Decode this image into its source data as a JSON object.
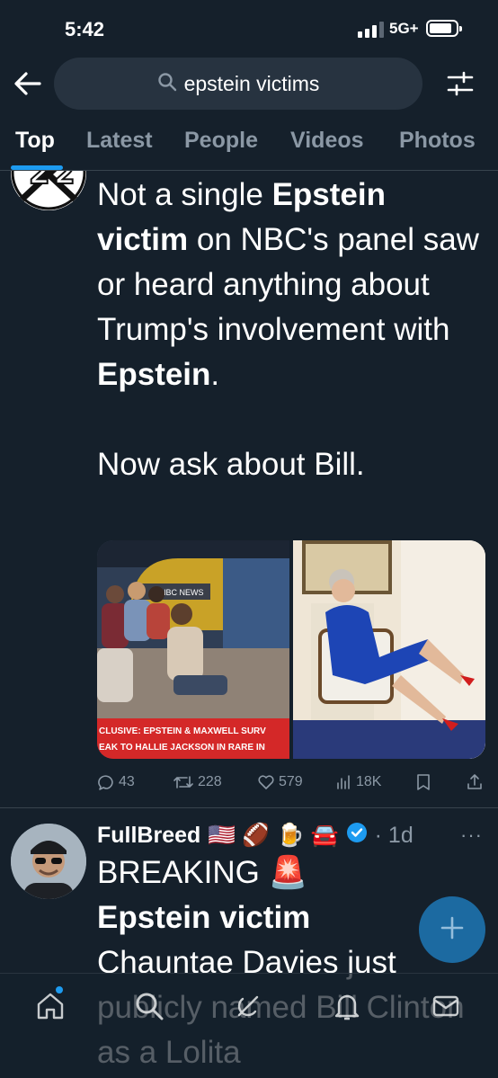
{
  "status_bar": {
    "time": "5:42",
    "network": "5G+"
  },
  "search": {
    "query": "epstein victims"
  },
  "tabs": [
    {
      "label": "Top",
      "active": true
    },
    {
      "label": "Latest",
      "active": false
    },
    {
      "label": "People",
      "active": false
    },
    {
      "label": "Videos",
      "active": false
    },
    {
      "label": "Photos",
      "active": false
    }
  ],
  "tweet1": {
    "text_parts": {
      "p1": "Not a single ",
      "b1": "Epstein victim",
      "p2": " on NBC's panel saw or heard anything about Trump's involvement with ",
      "b2": "Epstein",
      "p3": ".",
      "p4": "Now ask about Bill."
    },
    "media": {
      "left_banner_line1": "CLUSIVE: EPSTEIN & MAXWELL SURV",
      "left_banner_line2": "EAK TO HALLIE JACKSON IN RARE IN",
      "nbc_label": "NBC NEWS"
    },
    "stats": {
      "replies": "43",
      "reposts": "228",
      "likes": "579",
      "views": "18K"
    }
  },
  "tweet2": {
    "name": "FullBreed",
    "emojis": "🇺🇸 🏈 🍺 🚘",
    "meta": "· 1d",
    "more": "···",
    "text_parts": {
      "p1": "BREAKING 🚨",
      "b1": "Epstein victim",
      "p2": "Chauntae Davies just publicly named Bill Clinton as a Lolita"
    }
  },
  "colors": {
    "background": "#15202b",
    "accent": "#1d9bf0",
    "muted": "#8b98a5",
    "fab": "#1d6fa8"
  },
  "icons": {
    "back": "arrow-left-icon",
    "filter": "sliders-icon",
    "search": "search-icon",
    "verified": "verified-badge-icon"
  }
}
